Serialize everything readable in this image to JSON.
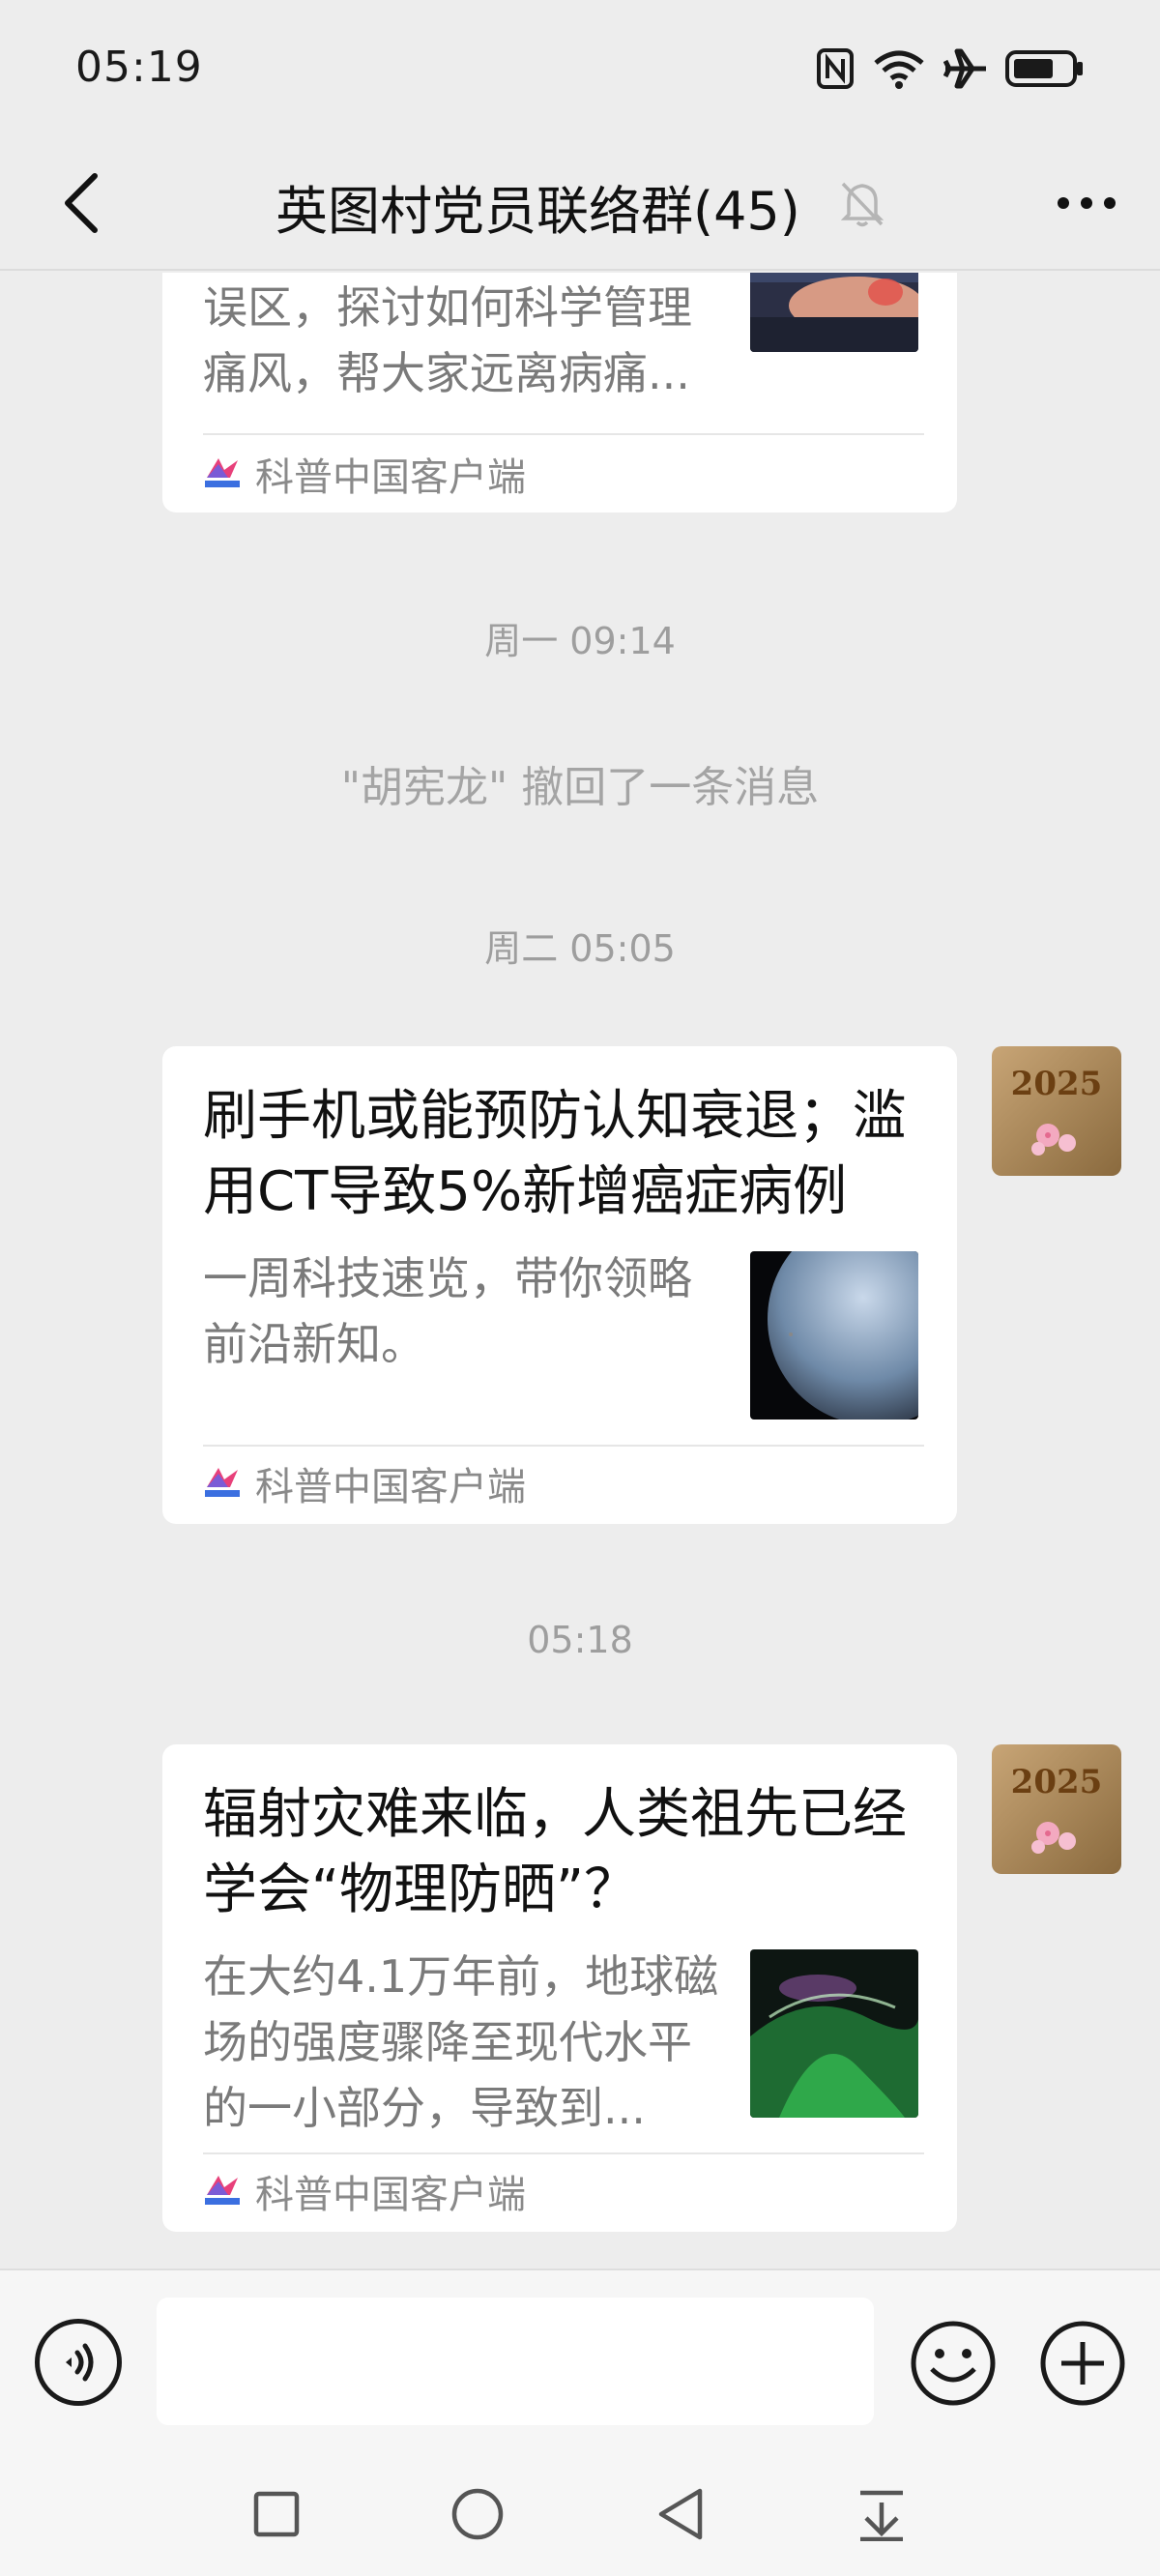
{
  "status_bar": {
    "time": "05:19",
    "icons": [
      "nfc-icon",
      "wifi-icon",
      "airplane-icon",
      "battery-icon"
    ]
  },
  "nav": {
    "title": "英图村党员联络群(45)",
    "back_icon": "chevron-left-icon",
    "mute_icon": "bell-off-icon",
    "more_icon": "more-dots-icon"
  },
  "messages": [
    {
      "type": "card",
      "desc": "误区，探讨如何科学管理痛风，帮大家远离病痛...",
      "source": "科普中国客户端"
    },
    {
      "type": "timestamp",
      "text": "周一 09:14"
    },
    {
      "type": "system",
      "text": "\"胡宪龙\" 撤回了一条消息"
    },
    {
      "type": "timestamp",
      "text": "周二 05:05"
    },
    {
      "type": "card",
      "title": "刷手机或能预防认知衰退；滥用CT导致5%新增癌症病例 |...",
      "desc": "一周科技速览，带你领略前沿新知。",
      "source": "科普中国客户端"
    },
    {
      "type": "timestamp",
      "text": "05:18"
    },
    {
      "type": "card",
      "title": "辐射灾难来临，人类祖先已经学会“物理防晒”？",
      "desc": "在大约4.1万年前，地球磁场的强度骤降至现代水平的一小部分，导致到...",
      "source": "科普中国客户端"
    }
  ],
  "avatar": {
    "text_year": "2025"
  },
  "input_bar": {
    "value": "",
    "voice_icon": "voice-icon",
    "emoji_icon": "emoji-icon",
    "plus_icon": "plus-icon"
  },
  "system_nav": [
    "recents-square-icon",
    "home-circle-icon",
    "back-triangle-icon",
    "notification-pull-icon"
  ],
  "colors": {
    "background": "#ededed",
    "card": "#ffffff",
    "meta_text": "#9e9e9e"
  }
}
